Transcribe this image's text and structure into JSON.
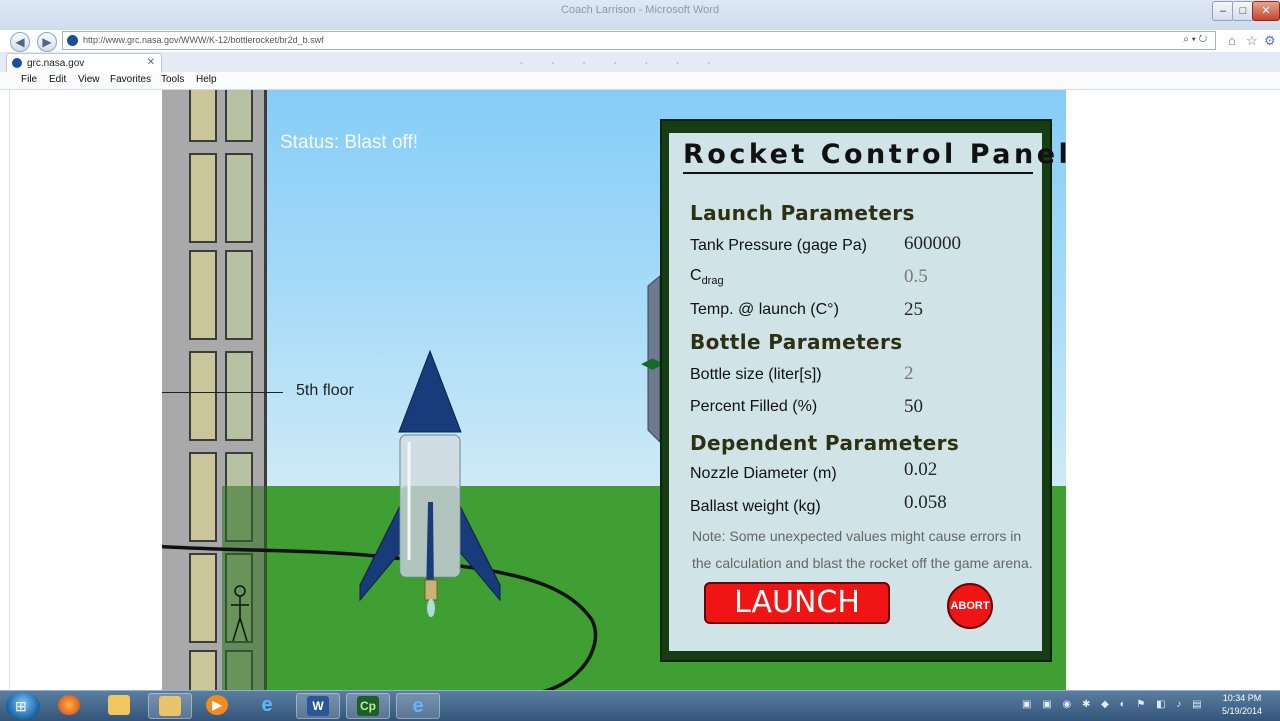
{
  "browser": {
    "window_title": "Coach Larrison - Microsoft Word",
    "url": "http://www.grc.nasa.gov/WWW/K-12/bottlerocket/br2d_b.swf",
    "tab_label": "grc.nasa.gov",
    "menu": [
      "File",
      "Edit",
      "View",
      "Favorites",
      "Tools",
      "Help"
    ]
  },
  "scene": {
    "status": "Status: Blast off!",
    "floor_label": "5th floor"
  },
  "panel": {
    "title": "Rocket Control Panel",
    "launch_section": "Launch Parameters",
    "tank_pressure_label": "Tank Pressure (gage Pa)",
    "tank_pressure_value": "600000",
    "cdrag_label": "C",
    "cdrag_sub": "drag",
    "cdrag_value": "0.5",
    "temp_label": "Temp. @ launch (C°)",
    "temp_value": "25",
    "bottle_section": "Bottle Parameters",
    "bottle_size_label": "Bottle size (liter[s])",
    "bottle_size_value": "2",
    "percent_filled_label": "Percent Filled (%)",
    "percent_filled_value": "50",
    "dependent_section": "Dependent Parameters",
    "nozzle_label": "Nozzle Diameter (m)",
    "nozzle_value": "0.02",
    "ballast_label": "Ballast weight (kg)",
    "ballast_value": "0.058",
    "note": "Note: Some unexpected values might cause errors in the calculation and blast the rocket off the game arena.",
    "launch_button": "LAUNCH",
    "abort_button": "ABORT"
  },
  "taskbar": {
    "time": "10:34 PM",
    "date": "5/19/2014",
    "items": [
      "firefox-icon",
      "folder-icon",
      "explorer-icon",
      "media-player-icon",
      "internet-explorer-icon",
      "word-icon",
      "captivate-icon",
      "internet-explorer-active-icon"
    ]
  }
}
